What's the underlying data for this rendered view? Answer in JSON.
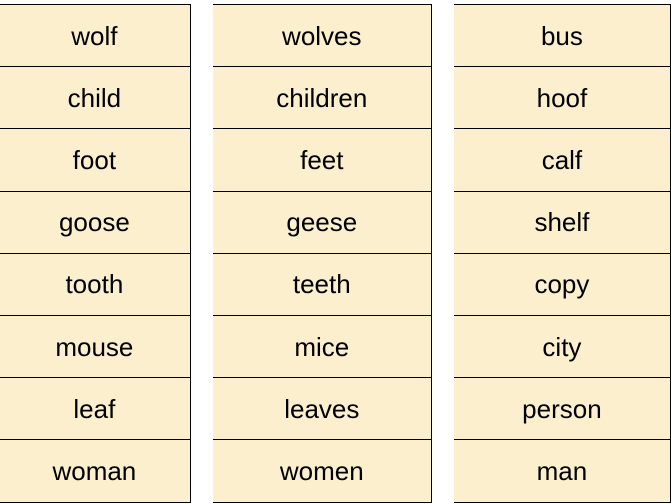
{
  "columns": [
    {
      "cells": [
        "wolf",
        "child",
        "foot",
        "goose",
        "tooth",
        "mouse",
        "leaf",
        "woman"
      ]
    },
    {
      "cells": [
        "wolves",
        "children",
        "feet",
        "geese",
        "teeth",
        "mice",
        "leaves",
        "women"
      ]
    },
    {
      "cells": [
        "bus",
        "hoof",
        "calf",
        "shelf",
        "copy",
        "city",
        "person",
        "man"
      ]
    }
  ]
}
